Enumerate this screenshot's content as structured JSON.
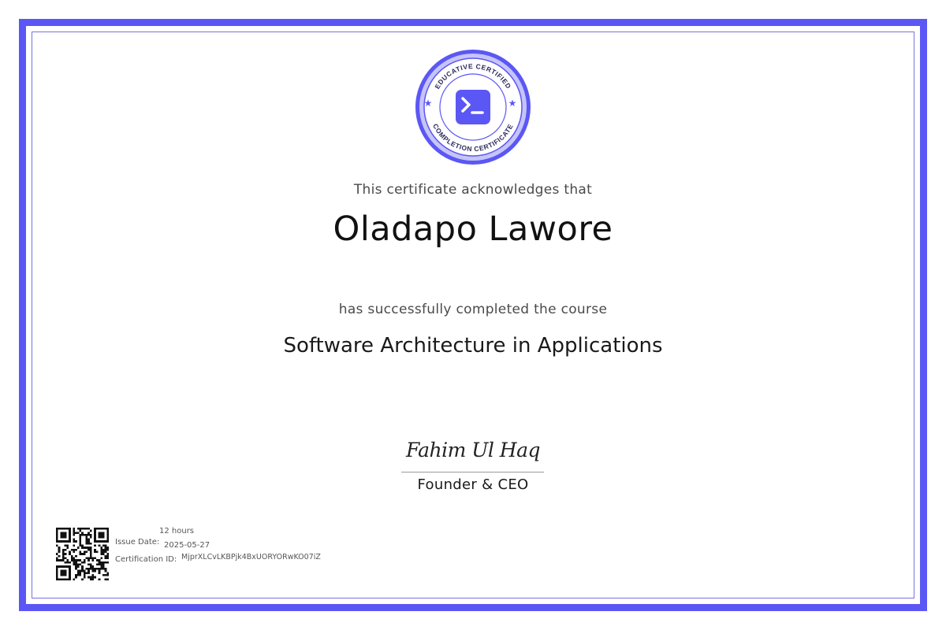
{
  "seal": {
    "top_text": "EDUCATIVE CERTIFIED",
    "bottom_text": "COMPLETION CERTIFICATE",
    "icon": "terminal-prompt-icon",
    "accent_color": "#5b57f5",
    "light_color": "#c6c4f8"
  },
  "certificate": {
    "acknowledgement": "This certificate acknowledges that",
    "recipient_name": "Oladapo Lawore",
    "completion_text": "has successfully completed the course",
    "course_title": "Software Architecture in Applications"
  },
  "signatory": {
    "signature": "Fahim Ul Haq",
    "role": "Founder & CEO"
  },
  "details": {
    "duration": "12 hours",
    "issue_date_label": "Issue Date:",
    "issue_date": "2025-05-27",
    "certification_id_label": "Certification ID:",
    "certification_id": "MjprXLCvLKBPjk4BxUORYORwKO07iZ"
  }
}
